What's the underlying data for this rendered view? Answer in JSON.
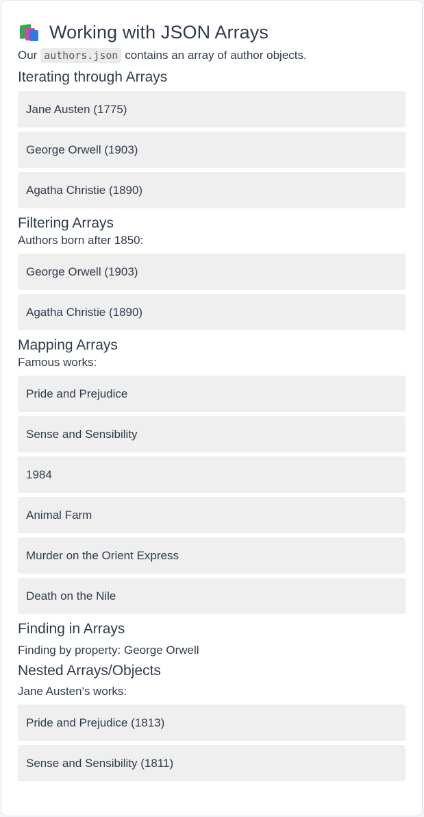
{
  "header": {
    "icon": "books-icon",
    "title": "Working with JSON Arrays",
    "intro_before": "Our",
    "intro_code": "authors.json",
    "intro_after": "contains an array of author objects."
  },
  "iterating": {
    "heading": "Iterating through Arrays",
    "items": [
      "Jane Austen (1775)",
      "George Orwell (1903)",
      "Agatha Christie (1890)"
    ]
  },
  "filtering": {
    "heading": "Filtering Arrays",
    "caption": "Authors born after 1850:",
    "items": [
      "George Orwell (1903)",
      "Agatha Christie (1890)"
    ]
  },
  "mapping": {
    "heading": "Mapping Arrays",
    "caption": "Famous works:",
    "items": [
      "Pride and Prejudice",
      "Sense and Sensibility",
      "1984",
      "Animal Farm",
      "Murder on the Orient Express",
      "Death on the Nile"
    ]
  },
  "finding": {
    "heading": "Finding in Arrays",
    "caption": "Finding by property: George Orwell"
  },
  "nested": {
    "heading": "Nested Arrays/Objects",
    "caption": "Jane Austen's works:",
    "items": [
      "Pride and Prejudice (1813)",
      "Sense and Sensibility (1811)"
    ]
  }
}
